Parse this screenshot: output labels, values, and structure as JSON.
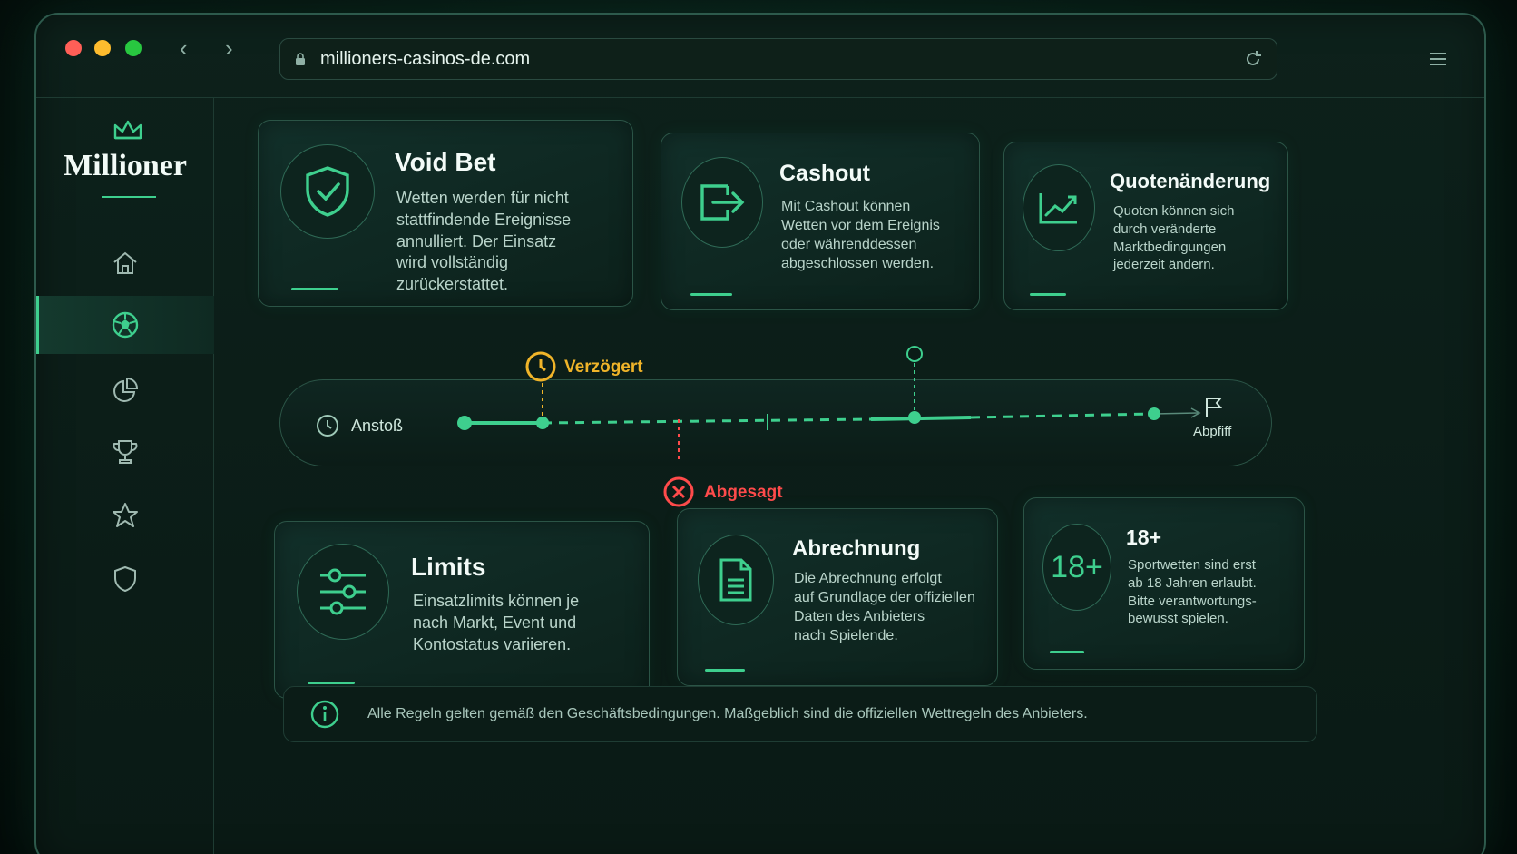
{
  "browser": {
    "url": "millioners-casinos-de.com",
    "back_icon": "chevron-left-icon",
    "forward_icon": "chevron-right-icon"
  },
  "brand": {
    "name": "Millioner",
    "accent_color": "#3ecf8e"
  },
  "sidebar": {
    "items": [
      {
        "icon": "home-icon",
        "active": false
      },
      {
        "icon": "soccer-ball-icon",
        "active": true
      },
      {
        "icon": "pie-chart-icon",
        "active": false
      },
      {
        "icon": "trophy-icon",
        "active": false
      },
      {
        "icon": "star-icon",
        "active": false
      },
      {
        "icon": "shield-icon",
        "active": false
      }
    ]
  },
  "cards_top": [
    {
      "title": "Void Bet",
      "icon": "shield-check-icon",
      "text": [
        "Wetten werden für nicht",
        "stattfindende Ereignisse",
        "annulliert. Der Einsatz",
        "wird vollständig",
        "zurückerstattet."
      ]
    },
    {
      "title": "Cashout",
      "icon": "exit-arrow-icon",
      "text": [
        "Mit Cashout können",
        "Wetten vor dem Ereignis",
        "oder währenddessen",
        "abgeschlossen werden."
      ]
    },
    {
      "title": "Quotenänderung",
      "icon": "trend-chart-icon",
      "text": [
        "Quoten können sich",
        "durch veränderte",
        "Marktbedingungen",
        "jederzeit ändern."
      ]
    }
  ],
  "timeline": {
    "start_label": "Anstoß",
    "end_label": "Abpfiff",
    "delayed_label": "Verzögert",
    "cancelled_label": "Abgesagt",
    "delayed_color": "#f0b429",
    "cancelled_color": "#ff4b4b"
  },
  "cards_bottom": [
    {
      "title": "Limits",
      "icon": "sliders-icon",
      "text": [
        "Einsatzlimits können je",
        "nach Markt, Event und",
        "Kontostatus variieren."
      ]
    },
    {
      "title": "Abrechnung",
      "icon": "document-icon",
      "text": [
        "Die Abrechnung erfolgt",
        "auf Grundlage der offiziellen",
        "Daten des Anbieters",
        "nach Spielende."
      ]
    },
    {
      "title": "18+",
      "icon_text": "18+",
      "text": [
        "Sportwetten sind erst",
        "ab 18 Jahren erlaubt.",
        "Bitte verantwortungs-",
        "bewusst spielen."
      ]
    }
  ],
  "footer": {
    "text": "Alle Regeln gelten gemäß den Geschäftsbedingungen. Maßgeblich sind die offiziellen Wettregeln des Anbieters."
  }
}
